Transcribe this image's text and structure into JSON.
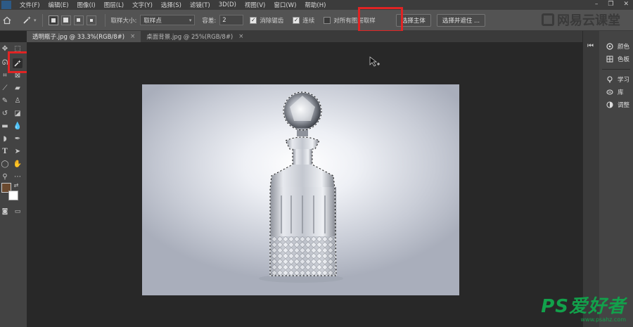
{
  "menu": {
    "items": [
      "文件(F)",
      "编辑(E)",
      "图像(I)",
      "图层(L)",
      "文字(Y)",
      "选择(S)",
      "滤镜(T)",
      "3D(D)",
      "视图(V)",
      "窗口(W)",
      "帮助(H)"
    ]
  },
  "options": {
    "sample_size_label": "取样大小:",
    "sample_size_value": "取样点",
    "tolerance_label": "容差:",
    "tolerance_value": "2",
    "antialias_label": "消除锯齿",
    "antialias_checked": true,
    "contiguous_label": "连续",
    "contiguous_checked": true,
    "sample_all_layers_label": "对所有图层取样",
    "sample_all_layers_checked": false,
    "select_subject_label": "选择主体",
    "select_and_mask_label": "选择并遮住 ..."
  },
  "branding": {
    "top_watermark": "网易云课堂",
    "site_brand": "PS爱好者",
    "site_url": "www.psahz.com"
  },
  "tabs": [
    {
      "label": "透明瓶子.jpg @ 33.3%(RGB/8#)",
      "active": true
    },
    {
      "label": "桌面背景.jpg @ 25%(RGB/8#)",
      "active": false
    }
  ],
  "panels": {
    "items": [
      {
        "label": "颜色",
        "icon": "color-wheel-icon"
      },
      {
        "label": "色板",
        "icon": "swatches-grid-icon"
      },
      {
        "label": "学习",
        "icon": "lightbulb-icon"
      },
      {
        "label": "库",
        "icon": "library-icon"
      },
      {
        "label": "调整",
        "icon": "adjustments-circle-icon"
      }
    ]
  },
  "colors": {
    "foreground": "#6b4a2f",
    "background": "#ffffff",
    "highlight": "#e02424",
    "brand_green": "#12a14b"
  }
}
